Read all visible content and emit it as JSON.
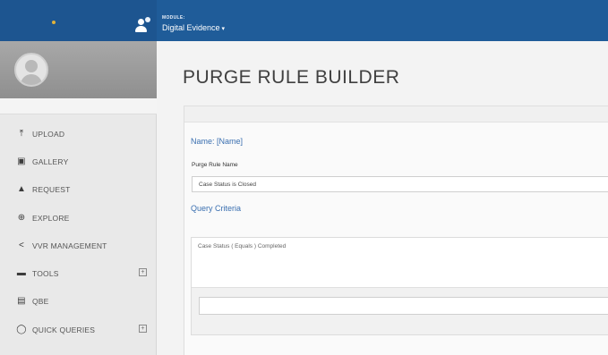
{
  "topbar": {
    "module_label": "MODULE:",
    "module_value": "Digital Evidence",
    "module_chevron": "▾",
    "brand_color": "#1f5c99"
  },
  "sidebar": {
    "items": [
      {
        "label": "UPLOAD",
        "icon": "upload-icon",
        "glyph": "⤒"
      },
      {
        "label": "GALLERY",
        "icon": "gallery-icon",
        "glyph": "▣"
      },
      {
        "label": "REQUEST",
        "icon": "request-icon",
        "glyph": "▲"
      },
      {
        "label": "EXPLORE",
        "icon": "globe-icon",
        "glyph": "⊕"
      },
      {
        "label": "VVR MANAGEMENT",
        "icon": "share-icon",
        "glyph": "<"
      },
      {
        "label": "TOOLS",
        "icon": "briefcase-icon",
        "glyph": "▬",
        "expand": "+"
      },
      {
        "label": "QBE",
        "icon": "qbe-icon",
        "glyph": "▤"
      },
      {
        "label": "QUICK QUERIES",
        "icon": "chat-icon",
        "glyph": "◯",
        "expand": "+"
      }
    ]
  },
  "main": {
    "title": "PURGE RULE BUILDER",
    "name_heading": "Name: [Name]",
    "rule_name_label": "Purge Rule Name",
    "rule_name_value": "Case Status is Closed",
    "query_heading": "Query Criteria",
    "query_text": "Case Status ( Equals ) Completed"
  },
  "colors": {
    "accent_text": "#3a6fb0",
    "sidebar_bg": "#e9e9e9"
  }
}
